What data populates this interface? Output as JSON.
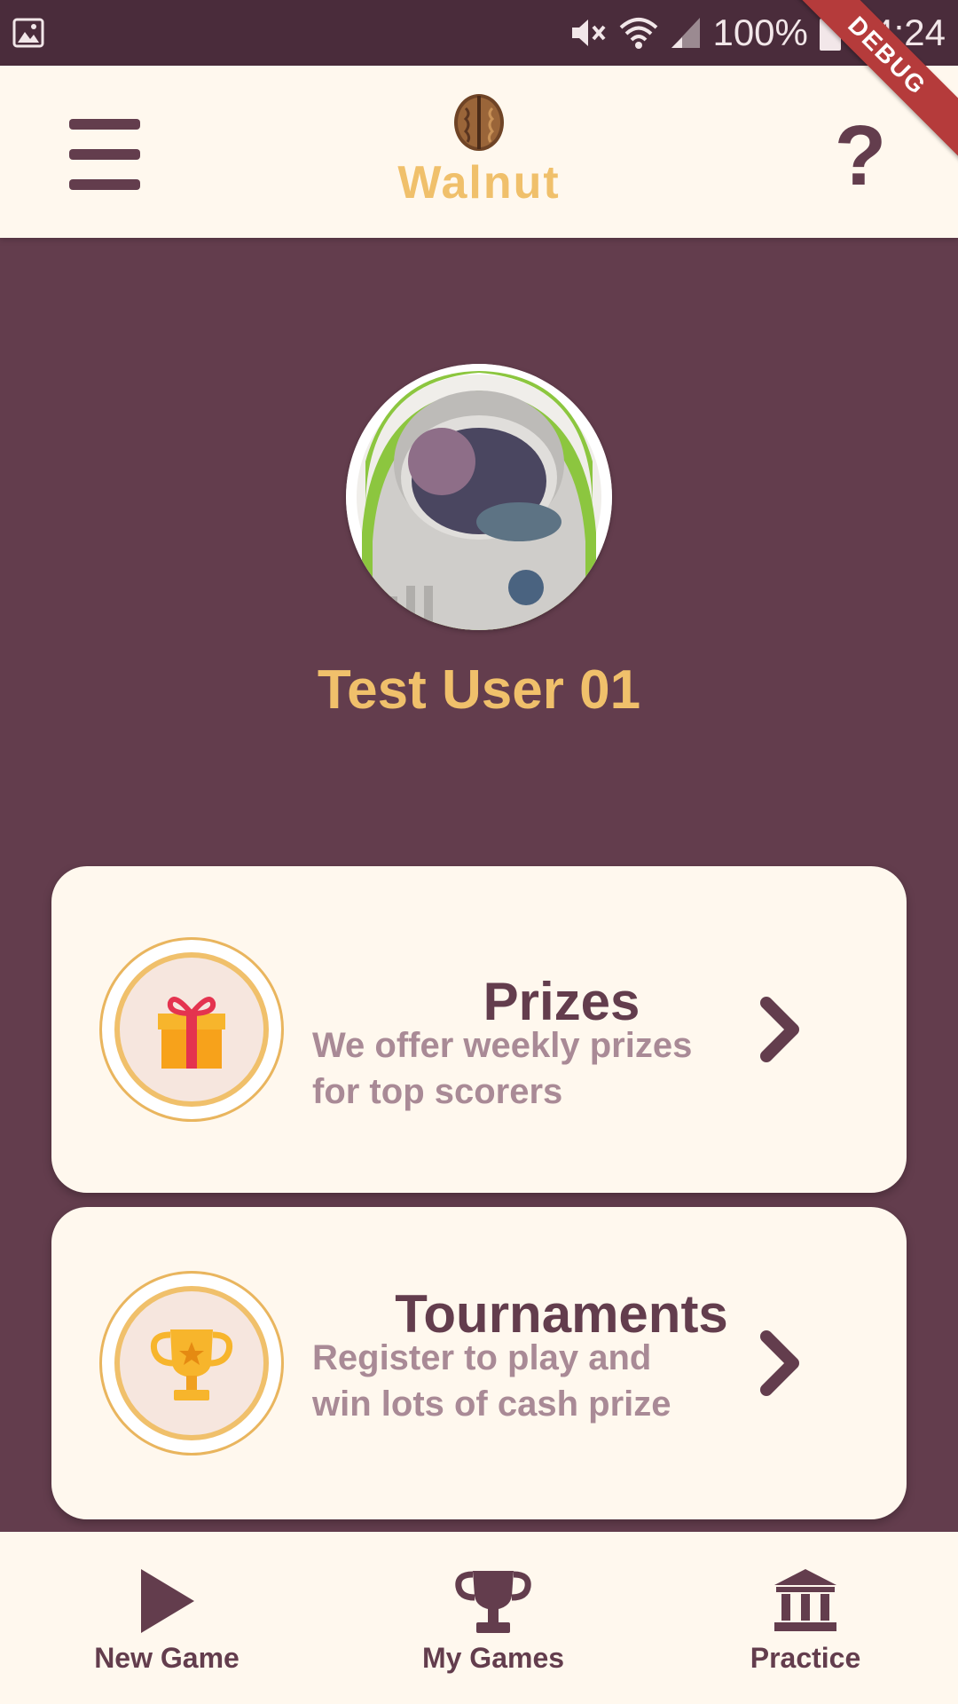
{
  "status_bar": {
    "battery_percent": "100%",
    "time": "14:24",
    "debug_label": "DEBUG",
    "icons": [
      "gallery-icon",
      "mute-icon",
      "wifi-icon",
      "signal-icon",
      "battery-icon"
    ]
  },
  "header": {
    "logo_text": "Walnut",
    "menu_icon": "hamburger-menu-icon",
    "help_icon": "question-mark-icon",
    "help_glyph": "?"
  },
  "profile": {
    "username": "Test User 01",
    "avatar": "astronaut-avatar"
  },
  "cards": [
    {
      "title": "Prizes",
      "desc_line1": "We offer weekly prizes",
      "desc_line2": "for top scorers",
      "icon": "gift-icon"
    },
    {
      "title": "Tournaments",
      "desc_line1": "Register to play and",
      "desc_line2": "win lots of cash prize",
      "icon": "trophy-icon"
    }
  ],
  "bottom_nav": {
    "items": [
      {
        "label": "New Game",
        "icon": "play-icon"
      },
      {
        "label": "My Games",
        "icon": "trophy-icon"
      },
      {
        "label": "Practice",
        "icon": "bank-icon"
      }
    ]
  },
  "colors": {
    "background": "#633d4d",
    "status_bar": "#4a2c3b",
    "surface": "#fff8ee",
    "accent": "#f0c06b",
    "text_primary": "#633d4d",
    "text_secondary": "#a98a96"
  }
}
